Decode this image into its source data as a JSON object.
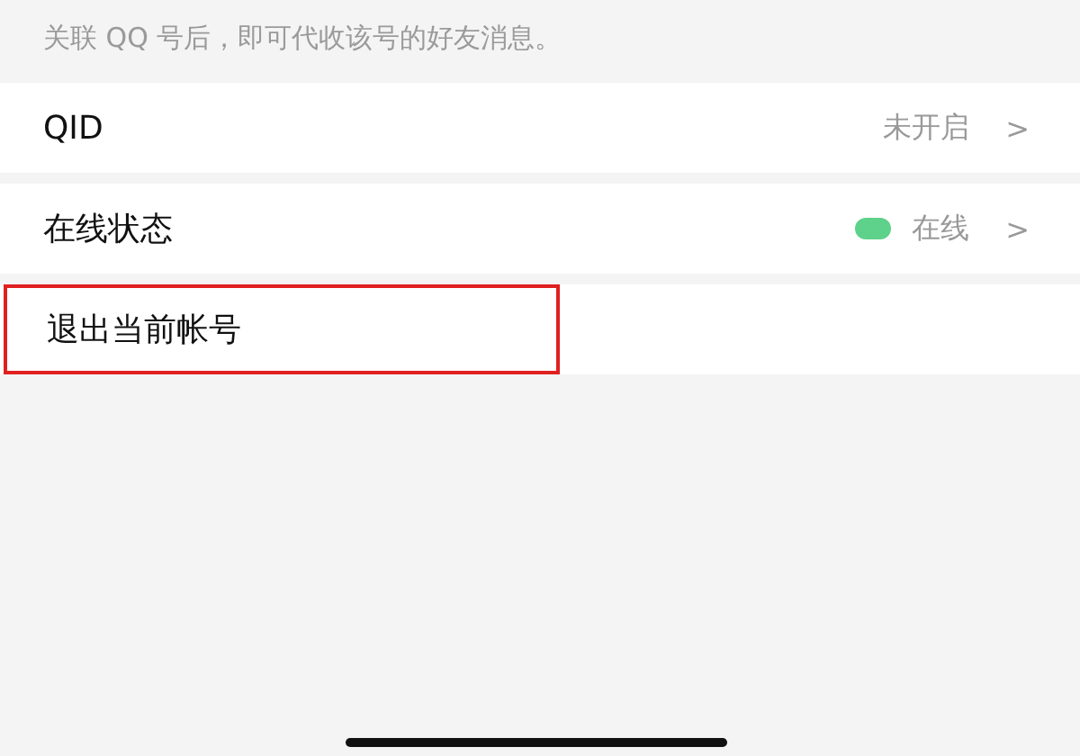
{
  "hint": "关联 QQ 号后，即可代收该号的好友消息。",
  "rows": [
    {
      "kind": "value",
      "label": "QID",
      "value": "未开启",
      "chevron": ">"
    },
    {
      "kind": "status",
      "label": "在线状态",
      "value": "在线",
      "color": "#5ed18a",
      "chevron": ">"
    },
    {
      "kind": "action",
      "label": "退出当前帐号",
      "highlighted": true
    }
  ]
}
